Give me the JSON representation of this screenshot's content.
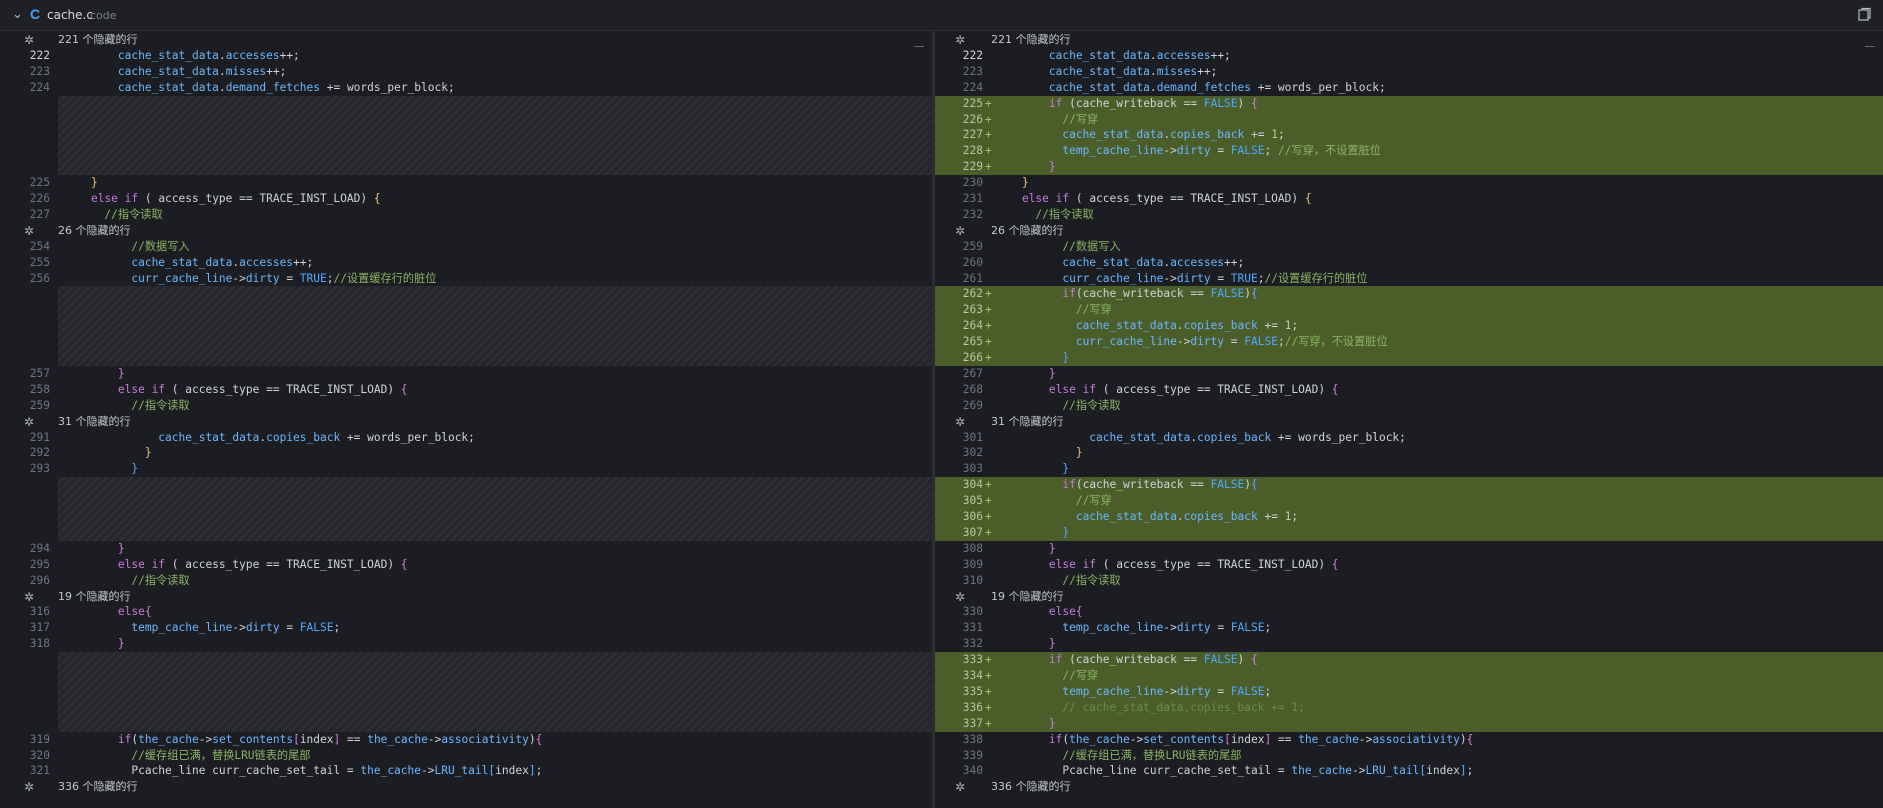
{
  "header": {
    "collapse_icon": "chevron-down-icon",
    "lang_badge": "C",
    "file_name": "cache.c",
    "file_lang": "code",
    "copy_icon": "open-file-icon"
  },
  "hidden_label_suffix": "个隐藏的行",
  "left": {
    "rows": [
      {
        "type": "hidden",
        "text": "221 个隐藏的行"
      },
      {
        "type": "code",
        "ln": "222",
        "active": true,
        "html": "        <span class='id'>cache_stat_data</span>.<span class='id'>accesses</span>++;"
      },
      {
        "type": "code",
        "ln": "223",
        "html": "        <span class='id'>cache_stat_data</span>.<span class='id'>misses</span>++;"
      },
      {
        "type": "code",
        "ln": "224",
        "html": "        <span class='id'>cache_stat_data</span>.<span class='id'>demand_fetches</span> += <span>words_per_block</span>;"
      },
      {
        "type": "gap",
        "rows": 5
      },
      {
        "type": "code",
        "ln": "225",
        "html": "    <span class='br1'>}</span>"
      },
      {
        "type": "code",
        "ln": "226",
        "html": "    <span class='kw'>else if</span> ( access_type == TRACE_INST_LOAD) <span class='br1'>{</span>"
      },
      {
        "type": "code",
        "ln": "227",
        "html": "      <span class='cm'>//指令读取</span>"
      },
      {
        "type": "hidden",
        "text": "26 个隐藏的行"
      },
      {
        "type": "code",
        "ln": "254",
        "html": "          <span class='cm'>//数据写入</span>"
      },
      {
        "type": "code",
        "ln": "255",
        "html": "          <span class='id'>cache_stat_data</span>.<span class='id'>accesses</span>++;"
      },
      {
        "type": "code",
        "ln": "256",
        "html": "          <span class='id'>curr_cache_line</span>-><span class='id'>dirty</span> = <span class='cn'>TRUE</span>;<span class='cm'>//设置缓存行的脏位</span>"
      },
      {
        "type": "gap",
        "rows": 5
      },
      {
        "type": "code",
        "ln": "257",
        "html": "        <span class='br2'>}</span>"
      },
      {
        "type": "code",
        "ln": "258",
        "html": "        <span class='kw'>else if</span> ( access_type == TRACE_INST_LOAD) <span class='br2'>{</span>"
      },
      {
        "type": "code",
        "ln": "259",
        "html": "          <span class='cm'>//指令读取</span>"
      },
      {
        "type": "hidden",
        "text": "31 个隐藏的行"
      },
      {
        "type": "code",
        "ln": "291",
        "html": "              <span class='id'>cache_stat_data</span>.<span class='id'>copies_back</span> += words_per_block;"
      },
      {
        "type": "code",
        "ln": "292",
        "html": "            <span class='br1'>}</span>"
      },
      {
        "type": "code",
        "ln": "293",
        "html": "          <span class='br3'>}</span>"
      },
      {
        "type": "gap",
        "rows": 4
      },
      {
        "type": "code",
        "ln": "294",
        "html": "        <span class='br2'>}</span>"
      },
      {
        "type": "code",
        "ln": "295",
        "html": "        <span class='kw'>else if</span> ( access_type == TRACE_INST_LOAD) <span class='br2'>{</span>"
      },
      {
        "type": "code",
        "ln": "296",
        "html": "          <span class='cm'>//指令读取</span>"
      },
      {
        "type": "hidden",
        "text": "19 个隐藏的行"
      },
      {
        "type": "code",
        "ln": "316",
        "html": "        <span class='kw'>else</span><span class='br2'>{</span>"
      },
      {
        "type": "code",
        "ln": "317",
        "html": "          <span class='id'>temp_cache_line</span>-><span class='id'>dirty</span> = <span class='cn'>FALSE</span>;"
      },
      {
        "type": "code",
        "ln": "318",
        "html": "        <span class='br2'>}</span>"
      },
      {
        "type": "gap",
        "rows": 5
      },
      {
        "type": "code",
        "ln": "319",
        "html": "        <span class='kw'>if</span>(<span class='id'>the_cache</span>-><span class='id'>set_contents</span><span class='br2'>[</span>index<span class='br2'>]</span> == <span class='id'>the_cache</span>-><span class='id'>associativity</span>)<span class='br2'>{</span>"
      },
      {
        "type": "code",
        "ln": "320",
        "html": "          <span class='cm'>//缓存组已满，替换LRU链表的尾部</span>"
      },
      {
        "type": "code",
        "ln": "321",
        "html": "          Pcache_line curr_cache_set_tail = <span class='id'>the_cache</span>-><span class='id'>LRU_tail</span><span class='br3'>[</span>index<span class='br3'>]</span>;"
      },
      {
        "type": "hidden",
        "text": "336 个隐藏的行"
      }
    ]
  },
  "right": {
    "rows": [
      {
        "type": "hidden",
        "text": "221 个隐藏的行"
      },
      {
        "type": "code",
        "ln": "222",
        "active": true,
        "html": "        <span class='id'>cache_stat_data</span>.<span class='id'>accesses</span>++;"
      },
      {
        "type": "code",
        "ln": "223",
        "html": "        <span class='id'>cache_stat_data</span>.<span class='id'>misses</span>++;"
      },
      {
        "type": "code",
        "ln": "224",
        "html": "        <span class='id'>cache_stat_data</span>.<span class='id'>demand_fetches</span> += words_per_block;"
      },
      {
        "type": "add",
        "ln": "225",
        "html": "        <span class='kw'>if</span> (cache_writeback == <span class='cn'>FALSE</span>) <span class='br2'>{</span>"
      },
      {
        "type": "add",
        "ln": "226",
        "html": "          <span class='cm'>//写穿</span>"
      },
      {
        "type": "add",
        "ln": "227",
        "html": "          <span class='id'>cache_stat_data</span>.<span class='id'>copies_back</span> += <span class='num'>1</span>;"
      },
      {
        "type": "add",
        "ln": "228",
        "html": "          <span class='id'>temp_cache_line</span>-><span class='id'>dirty</span> = <span class='cn'>FALSE</span>; <span class='cm'>//写穿，不设置脏位</span>"
      },
      {
        "type": "add",
        "ln": "229",
        "html": "        <span class='br2'>}</span>"
      },
      {
        "type": "code",
        "ln": "230",
        "html": "    <span class='br1'>}</span>"
      },
      {
        "type": "code",
        "ln": "231",
        "html": "    <span class='kw'>else if</span> ( access_type == TRACE_INST_LOAD) <span class='br1'>{</span>"
      },
      {
        "type": "code",
        "ln": "232",
        "html": "      <span class='cm'>//指令读取</span>"
      },
      {
        "type": "hidden",
        "text": "26 个隐藏的行"
      },
      {
        "type": "code",
        "ln": "259",
        "html": "          <span class='cm'>//数据写入</span>"
      },
      {
        "type": "code",
        "ln": "260",
        "html": "          <span class='id'>cache_stat_data</span>.<span class='id'>accesses</span>++;"
      },
      {
        "type": "code",
        "ln": "261",
        "html": "          <span class='id'>curr_cache_line</span>-><span class='id'>dirty</span> = <span class='cn'>TRUE</span>;<span class='cm'>//设置缓存行的脏位</span>"
      },
      {
        "type": "add",
        "ln": "262",
        "html": "          <span class='kw'>if</span>(cache_writeback == <span class='cn'>FALSE</span>)<span class='br3'>{</span>"
      },
      {
        "type": "add",
        "ln": "263",
        "html": "            <span class='cm'>//写穿</span>"
      },
      {
        "type": "add",
        "ln": "264",
        "html": "            <span class='id'>cache_stat_data</span>.<span class='id'>copies_back</span> += <span class='num'>1</span>;"
      },
      {
        "type": "add",
        "ln": "265",
        "html": "            <span class='id'>curr_cache_line</span>-><span class='id'>dirty</span> = <span class='cn'>FALSE</span>;<span class='cm'>//写穿，不设置脏位</span>"
      },
      {
        "type": "add",
        "ln": "266",
        "html": "          <span class='br3'>}</span>"
      },
      {
        "type": "code",
        "ln": "267",
        "html": "        <span class='br2'>}</span>"
      },
      {
        "type": "code",
        "ln": "268",
        "html": "        <span class='kw'>else if</span> ( access_type == TRACE_INST_LOAD) <span class='br2'>{</span>"
      },
      {
        "type": "code",
        "ln": "269",
        "html": "          <span class='cm'>//指令读取</span>"
      },
      {
        "type": "hidden",
        "text": "31 个隐藏的行"
      },
      {
        "type": "code",
        "ln": "301",
        "html": "              <span class='id'>cache_stat_data</span>.<span class='id'>copies_back</span> += words_per_block;"
      },
      {
        "type": "code",
        "ln": "302",
        "html": "            <span class='br1'>}</span>"
      },
      {
        "type": "code",
        "ln": "303",
        "html": "          <span class='br3'>}</span>"
      },
      {
        "type": "add",
        "ln": "304",
        "html": "          <span class='kw'>if</span>(cache_writeback == <span class='cn'>FALSE</span>)<span class='br3'>{</span>"
      },
      {
        "type": "add",
        "ln": "305",
        "html": "            <span class='cm'>//写穿</span>"
      },
      {
        "type": "add",
        "ln": "306",
        "html": "            <span class='id'>cache_stat_data</span>.<span class='id'>copies_back</span> += <span class='num'>1</span>;"
      },
      {
        "type": "add",
        "ln": "307",
        "html": "          <span class='br3'>}</span>"
      },
      {
        "type": "code",
        "ln": "308",
        "html": "        <span class='br2'>}</span>"
      },
      {
        "type": "code",
        "ln": "309",
        "html": "        <span class='kw'>else if</span> ( access_type == TRACE_INST_LOAD) <span class='br2'>{</span>"
      },
      {
        "type": "code",
        "ln": "310",
        "html": "          <span class='cm'>//指令读取</span>"
      },
      {
        "type": "hidden",
        "text": "19 个隐藏的行"
      },
      {
        "type": "code",
        "ln": "330",
        "html": "        <span class='kw'>else</span><span class='br2'>{</span>"
      },
      {
        "type": "code",
        "ln": "331",
        "html": "          <span class='id'>temp_cache_line</span>-><span class='id'>dirty</span> = <span class='cn'>FALSE</span>;"
      },
      {
        "type": "code",
        "ln": "332",
        "html": "        <span class='br2'>}</span>"
      },
      {
        "type": "add",
        "ln": "333",
        "html": "        <span class='kw'>if</span> (cache_writeback == <span class='cn'>FALSE</span>) <span class='br2'>{</span>"
      },
      {
        "type": "add",
        "ln": "334",
        "html": "          <span class='cm'>//写穿</span>"
      },
      {
        "type": "add",
        "ln": "335",
        "html": "          <span class='id'>temp_cache_line</span>-><span class='id'>dirty</span> = <span class='cn'>FALSE</span>;"
      },
      {
        "type": "add",
        "ln": "336",
        "html": "          <span class='cmd'>// cache_stat_data.copies_back += 1;</span>"
      },
      {
        "type": "add",
        "ln": "337",
        "html": "        <span class='br2'>}</span>"
      },
      {
        "type": "code",
        "ln": "338",
        "html": "        <span class='kw'>if</span>(<span class='id'>the_cache</span>-><span class='id'>set_contents</span><span class='br2'>[</span>index<span class='br2'>]</span> == <span class='id'>the_cache</span>-><span class='id'>associativity</span>)<span class='br2'>{</span>"
      },
      {
        "type": "code",
        "ln": "339",
        "html": "          <span class='cm'>//缓存组已满，替换LRU链表的尾部</span>"
      },
      {
        "type": "code",
        "ln": "340",
        "html": "          Pcache_line curr_cache_set_tail = <span class='id'>the_cache</span>-><span class='id'>LRU_tail</span><span class='br3'>[</span>index<span class='br3'>]</span>;"
      },
      {
        "type": "hidden",
        "text": "336 个隐藏的行"
      }
    ]
  },
  "colors": {
    "added_bg": "#4b5e2a",
    "keyword": "#c678dd",
    "identifier": "#6cb6ff",
    "comment": "#8bb365"
  }
}
